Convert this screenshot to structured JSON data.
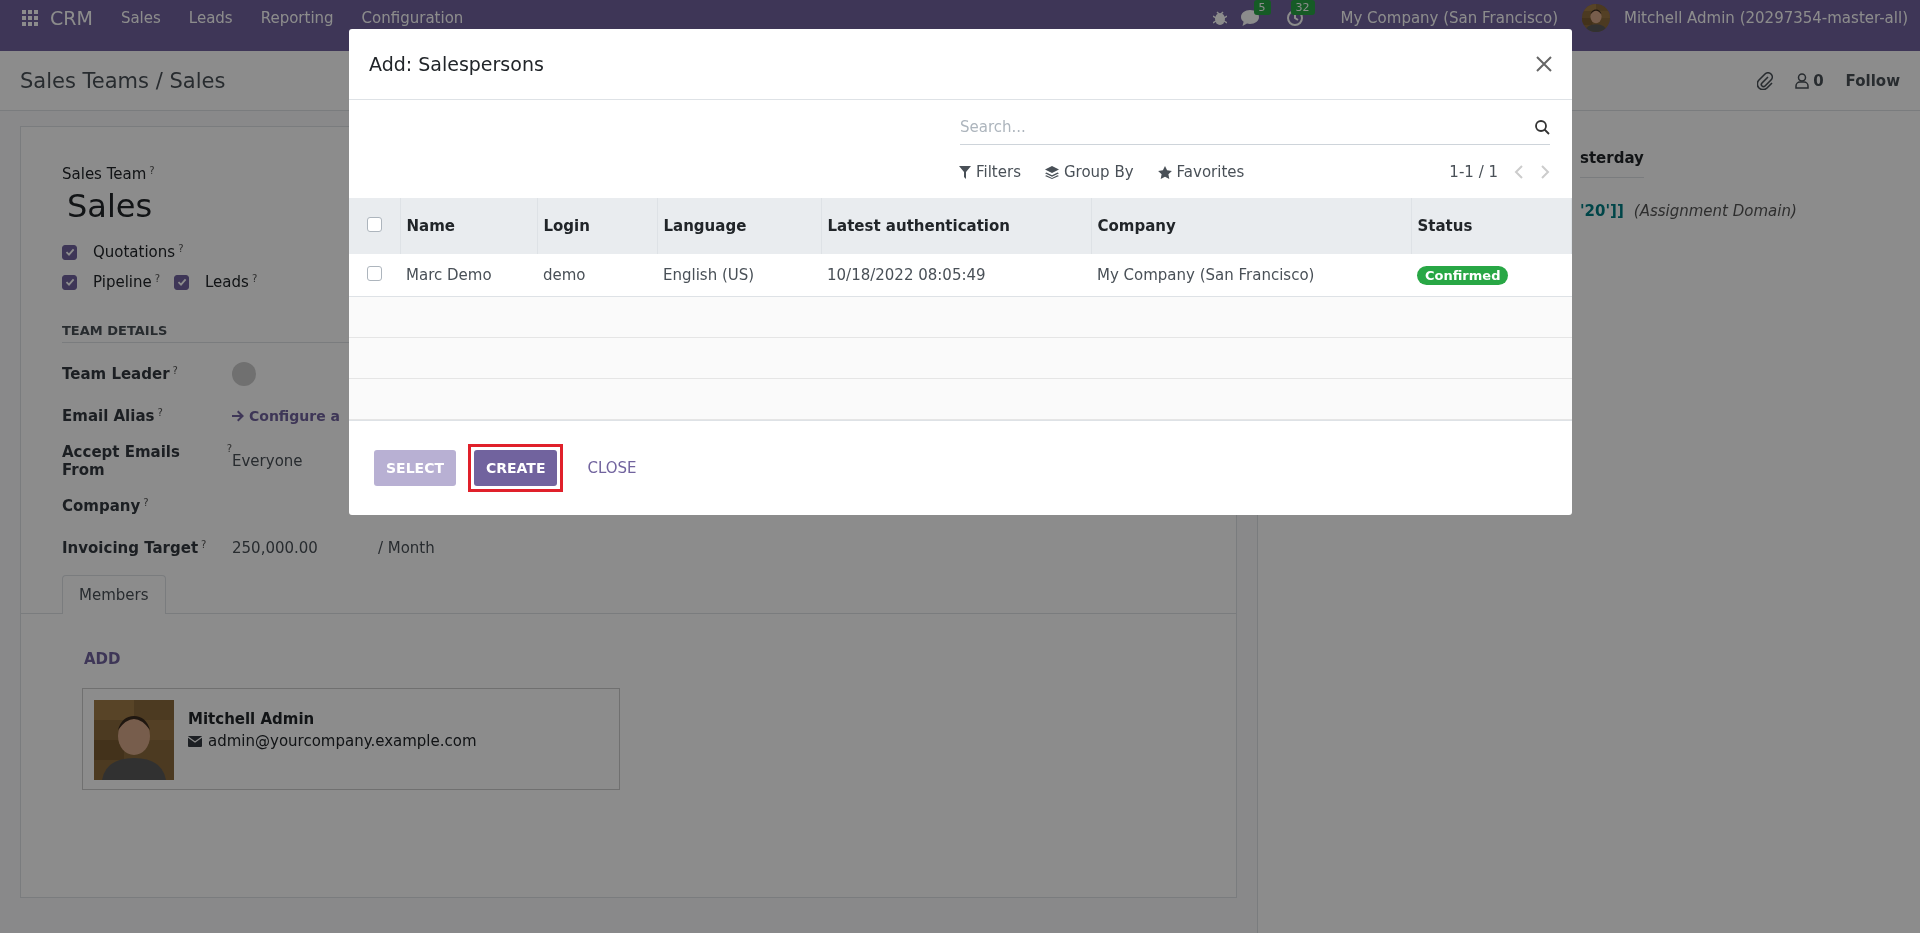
{
  "navbar": {
    "app": "CRM",
    "menu": [
      "Sales",
      "Leads",
      "Reporting",
      "Configuration"
    ],
    "badges": [
      {
        "kind": "chat",
        "count": "5"
      },
      {
        "kind": "activity",
        "count": "32"
      }
    ],
    "company": "My Company (San Francisco)",
    "user": "Mitchell Admin (20297354-master-all)"
  },
  "breadcrumb": "Sales Teams / Sales",
  "chatter": {
    "followers": "0",
    "follow": "Follow",
    "date": "sterday",
    "domain_value": "'20']]",
    "domain_label": "(Assignment Domain)"
  },
  "form": {
    "title_label": {
      "label": "Sales Team",
      "help": "?"
    },
    "title": "Sales",
    "option_rows": [
      [
        {
          "label": "Quotations",
          "help": "?",
          "checked": true
        }
      ],
      [
        {
          "label": "Pipeline",
          "help": "?",
          "checked": true
        },
        {
          "label": "Leads",
          "help": "?",
          "checked": true
        }
      ]
    ],
    "section": "TEAM DETAILS",
    "fields": [
      {
        "kind": "avatar",
        "label": "Team Leader",
        "help": "?"
      },
      {
        "kind": "link",
        "label": "Email Alias",
        "help": "?",
        "value": "Configure a"
      },
      {
        "kind": "text",
        "label": "Accept Emails From",
        "help": "?",
        "value": "Everyone"
      },
      {
        "kind": "empty",
        "label": "Company",
        "help": "?"
      },
      {
        "kind": "amount",
        "label": "Invoicing Target",
        "help": "?",
        "value": "250,000.00",
        "suffix": "/ Month"
      }
    ],
    "tabs": [
      {
        "label": "Members",
        "selected": true
      }
    ],
    "add": "ADD",
    "members": [
      {
        "name": "Mitchell Admin",
        "email": "admin@yourcompany.example.com"
      }
    ]
  },
  "dialog": {
    "title": "Add: Salespersons",
    "search": {
      "placeholder": "Search..."
    },
    "facets": [
      {
        "kind": "filter",
        "label": "Filters"
      },
      {
        "kind": "group",
        "label": "Group By"
      },
      {
        "kind": "star",
        "label": "Favorites"
      }
    ],
    "pager": "1-1 / 1",
    "table": {
      "columns": [
        "Name",
        "Login",
        "Language",
        "Latest authentication",
        "Company",
        "Status"
      ],
      "all_checked": false,
      "rows": [
        {
          "checked": false,
          "cells": [
            "Marc Demo",
            "demo",
            "English (US)",
            "10/18/2022 08:05:49",
            "My Company (San Francisco)"
          ],
          "status": "Confirmed"
        }
      ]
    },
    "buttons": [
      {
        "kind": "primary",
        "label": "SELECT",
        "disabled": true,
        "highlighted": false
      },
      {
        "kind": "primary",
        "label": "CREATE",
        "disabled": false,
        "highlighted": true
      },
      {
        "kind": "link",
        "label": "CLOSE",
        "disabled": false,
        "highlighted": false
      }
    ]
  }
}
